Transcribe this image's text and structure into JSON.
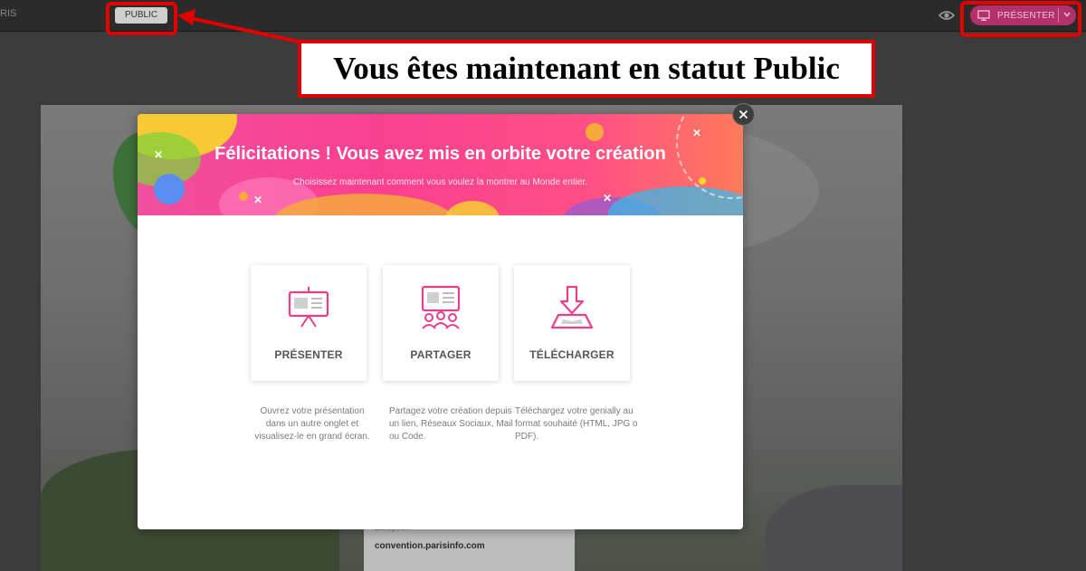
{
  "topbar": {
    "title_fragment": "RIS",
    "status_badge": "PUBLIC",
    "present_button": "PRÉSENTER"
  },
  "annotation": {
    "text": "Vous êtes maintenant en statut Public",
    "color": "#e30000"
  },
  "slide": {
    "footer_partial": "Européen",
    "footer_link": "convention.parisinfo.com"
  },
  "modal": {
    "title": "Félicitations ! Vous avez mis en orbite votre création",
    "subtitle": "Choisissez maintenant comment vous voulez la montrer au Monde entier.",
    "options": [
      {
        "label": "PRÉSENTER",
        "icon": "presentation-board-icon",
        "description": "Ouvrez votre présentation dans un autre onglet et visualisez-le en grand écran."
      },
      {
        "label": "PARTAGER",
        "icon": "share-audience-icon",
        "description": "Partagez votre création depuis un lien, Réseaux Sociaux, Mail ou Code."
      },
      {
        "label": "TÉLÉCHARGER",
        "icon": "download-icon",
        "description": "Téléchargez votre genially au format souhaité (HTML, JPG o PDF)."
      }
    ],
    "accent_color": "#e83e8c"
  }
}
